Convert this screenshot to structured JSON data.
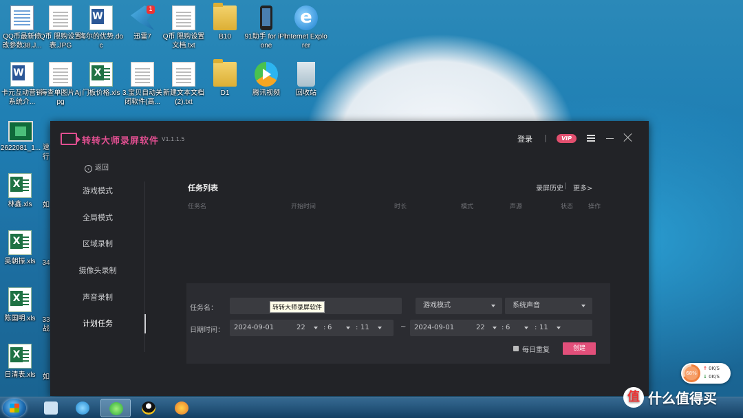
{
  "desktop": {
    "icons": [
      {
        "label": "QQ币最新修改参数38.J..."
      },
      {
        "label": "Q币 限购设置表.JPG"
      },
      {
        "label": "海尔的优势.doc"
      },
      {
        "label": "迅雷7",
        "badge": "1"
      },
      {
        "label": "Q币 限购设置文档.txt"
      },
      {
        "label": "B10"
      },
      {
        "label": "91助手 for iPhone"
      },
      {
        "label": "Internet Explorer"
      },
      {
        "label": "卡元互动营销系统介..."
      },
      {
        "label": "海查单图片Ajpg"
      },
      {
        "label": "门板价格.xls"
      },
      {
        "label": "3.宝贝自动关闭软件(高..."
      },
      {
        "label": "新建文本文档 (2).txt"
      },
      {
        "label": "D1"
      },
      {
        "label": "腾讯视频"
      },
      {
        "label": "回收站"
      },
      {
        "label": "2622081_1..."
      },
      {
        "label": "林鑫.xls"
      },
      {
        "label": "吴朝振.xls"
      },
      {
        "label": "陈国明.xls"
      },
      {
        "label": "日清表.xls"
      }
    ],
    "partial_labels": [
      "速",
      "行",
      "如",
      "34",
      "33",
      "战",
      "如"
    ]
  },
  "app": {
    "title": "转转大师录屏软件",
    "version": "V1.1.1.5",
    "login": "登录",
    "separator": "|",
    "vip": "VIP",
    "back": "返回",
    "sidebar": [
      {
        "label": "游戏模式"
      },
      {
        "label": "全局模式"
      },
      {
        "label": "区域录制"
      },
      {
        "label": "摄像头录制"
      },
      {
        "label": "声音录制"
      },
      {
        "label": "计划任务"
      }
    ],
    "task_list": {
      "title": "任务列表",
      "history": "录屏历史",
      "sep": "|",
      "more": "更多>",
      "columns": [
        "任务名",
        "开始时间",
        "时长",
        "模式",
        "声源",
        "状态",
        "操作"
      ]
    },
    "form": {
      "name_label": "任务名：",
      "name_value": "转转大师录屏软件",
      "mode_value": "游戏模式",
      "sound_value": "系统声音",
      "date_label": "日期时间：",
      "start": {
        "date": "2024-09-01",
        "hour": "22",
        "minute": "6",
        "second": "11"
      },
      "tilde": "~",
      "end": {
        "date": "2024-09-01",
        "hour": "22",
        "minute": "6",
        "second": "11"
      },
      "colon": ":",
      "repeat_label": "每日重复",
      "create_label": "创建"
    }
  },
  "tray": {
    "percent": "68%",
    "up": "0K/S",
    "down": "0K/S"
  },
  "watermark": {
    "badge": "值",
    "text": "什么值得买"
  }
}
